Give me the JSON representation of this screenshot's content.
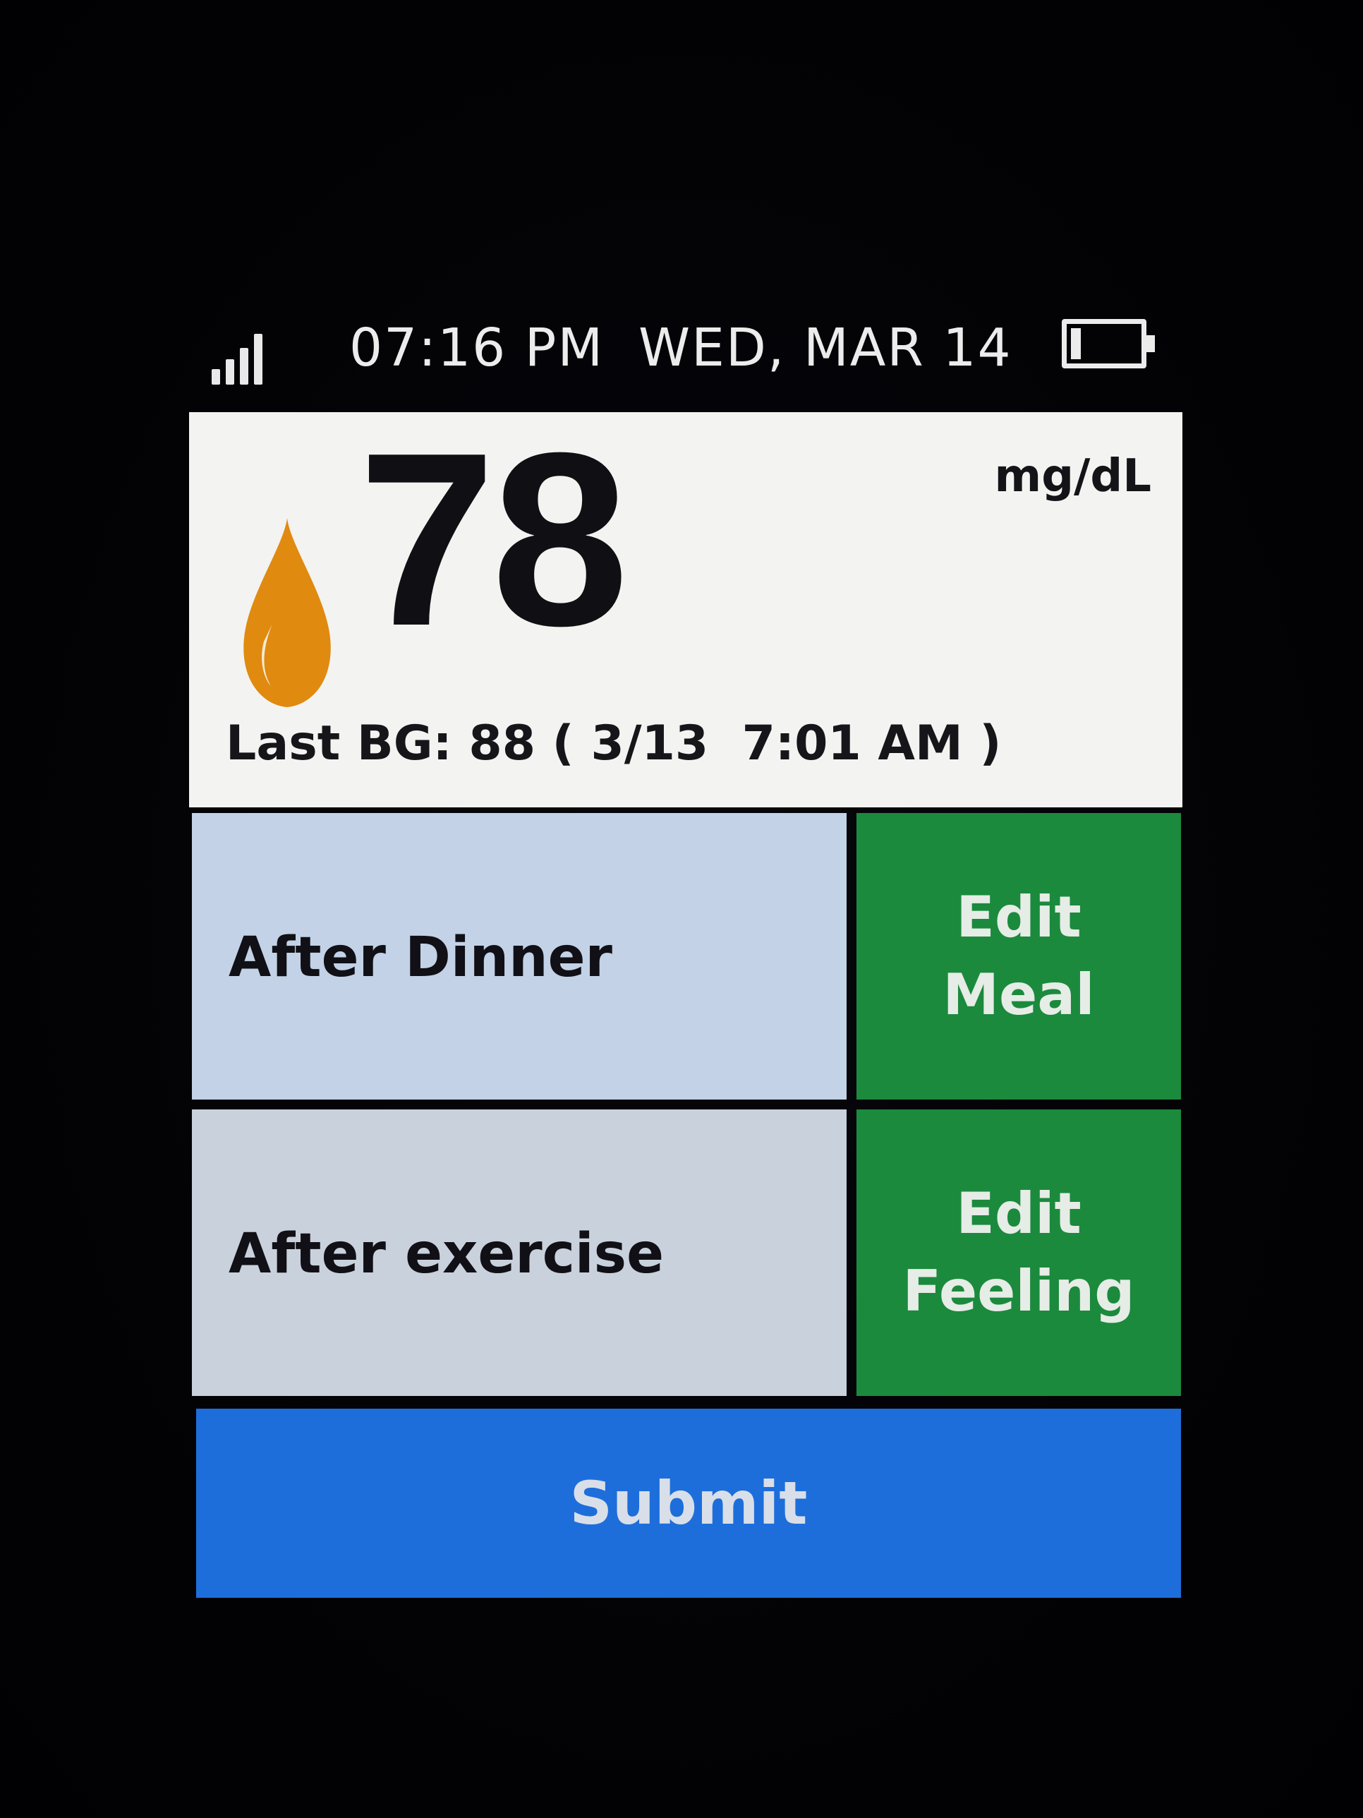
{
  "status_bar": {
    "time": "07:16 PM",
    "date": "WED, MAR 14",
    "signal_icon": "signal-bars-icon",
    "battery_icon": "battery-low-icon"
  },
  "reading": {
    "value": "78",
    "unit": "mg/dL",
    "drop_icon": "blood-drop-icon",
    "drop_color": "#e08a10",
    "last_bg": "Last BG: 88 ( 3/13  7:01 AM )"
  },
  "tags": [
    {
      "label": "After Dinner",
      "button_line1": "Edit",
      "button_line2": "Meal"
    },
    {
      "label": "After exercise",
      "button_line1": "Edit",
      "button_line2": "Feeling"
    }
  ],
  "submit_label": "Submit",
  "colors": {
    "edit_button": "#1b8a3d",
    "submit_button": "#1d6edb",
    "tag_cell": "#c3d2e6"
  }
}
